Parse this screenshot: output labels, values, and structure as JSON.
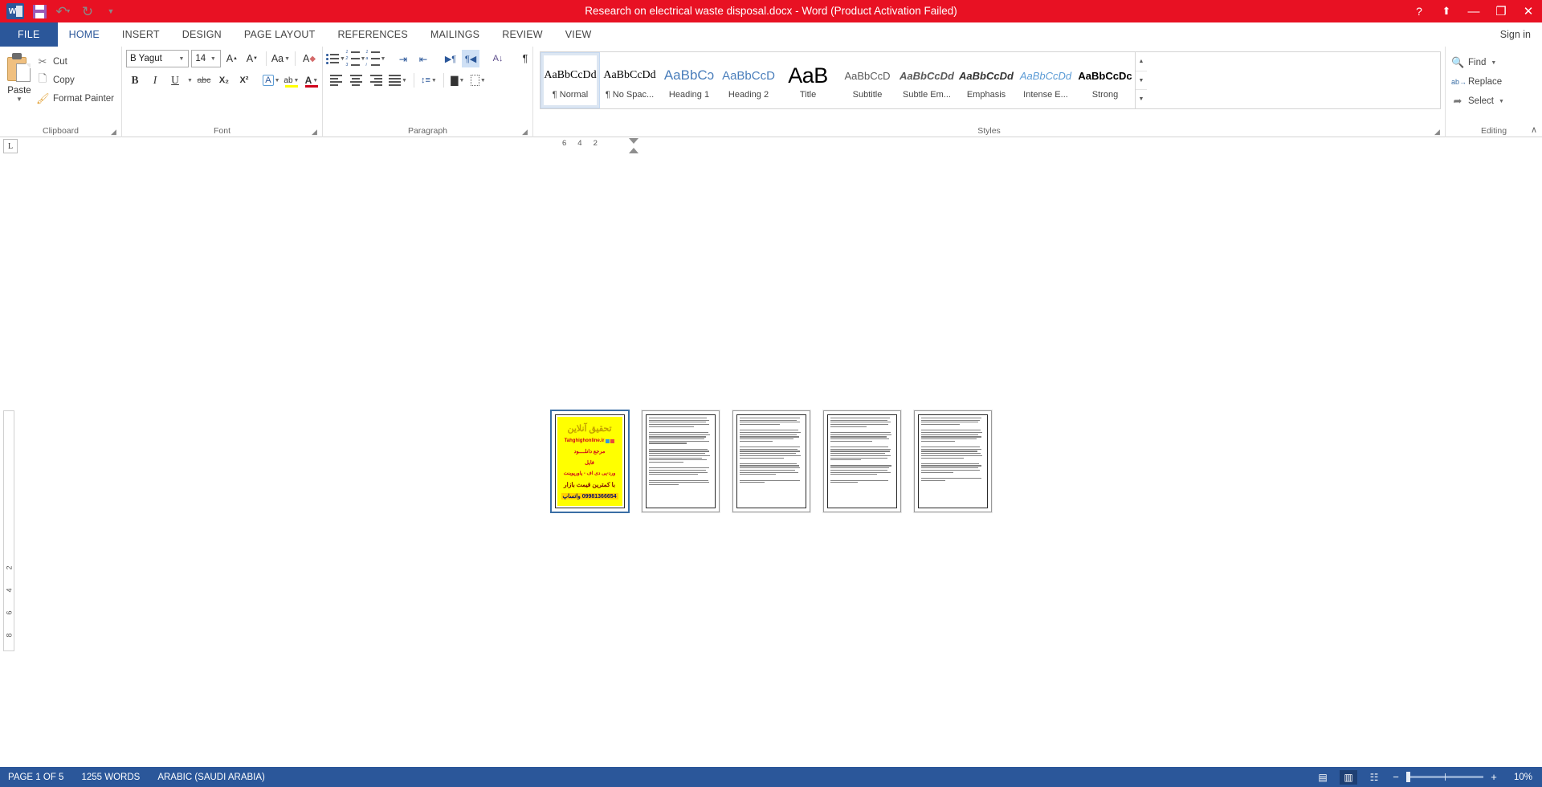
{
  "titlebar": {
    "title": "Research on electrical waste disposal.docx -  Word (Product Activation Failed)",
    "qat": [
      {
        "name": "word-app-icon",
        "label": "W"
      },
      {
        "name": "save-icon",
        "label": ""
      },
      {
        "name": "undo-icon",
        "label": "↶"
      },
      {
        "name": "redo-icon",
        "label": "↻"
      },
      {
        "name": "customize-qat-icon",
        "label": "≡"
      }
    ],
    "help_label": "?",
    "ribbon_display_label": "⬆",
    "minimize_label": "—",
    "restore_label": "❐",
    "close_label": "✕"
  },
  "tabs": {
    "file": "FILE",
    "items": [
      {
        "label": "HOME",
        "active": true
      },
      {
        "label": "INSERT",
        "active": false
      },
      {
        "label": "DESIGN",
        "active": false
      },
      {
        "label": "PAGE LAYOUT",
        "active": false
      },
      {
        "label": "REFERENCES",
        "active": false
      },
      {
        "label": "MAILINGS",
        "active": false
      },
      {
        "label": "REVIEW",
        "active": false
      },
      {
        "label": "VIEW",
        "active": false
      }
    ],
    "signin": "Sign in"
  },
  "ribbon": {
    "clipboard": {
      "group_label": "Clipboard",
      "paste_label": "Paste",
      "cut_label": "Cut",
      "copy_label": "Copy",
      "format_painter_label": "Format Painter"
    },
    "font": {
      "group_label": "Font",
      "font_name": "B Yagut",
      "font_size": "14",
      "grow_label": "A",
      "shrink_label": "A",
      "change_case_label": "Aa",
      "clear_format_label": "A",
      "bold_label": "B",
      "italic_label": "I",
      "underline_label": "U",
      "strike_label": "abc",
      "subscript_label": "X₂",
      "superscript_label": "X²",
      "text_effects_label": "A",
      "highlight_label": "ab",
      "font_color_label": "A"
    },
    "paragraph": {
      "group_label": "Paragraph",
      "show_marks_label": "¶",
      "sort_label": "A↓",
      "ltr_label": "▶¶",
      "rtl_label": "¶◀",
      "align_left_label": "",
      "align_center_label": "",
      "align_right_label": "",
      "justify_label": "",
      "line_spacing_label": "",
      "shading_label": "",
      "borders_label": ""
    },
    "styles": {
      "group_label": "Styles",
      "items": [
        {
          "preview": "AaBbCcDd",
          "name": "¶ Normal",
          "cls": "sp-normal",
          "selected": true
        },
        {
          "preview": "AaBbCcDd",
          "name": "¶ No Spac...",
          "cls": "sp-nospace",
          "selected": false
        },
        {
          "preview": "AaBbCɔ",
          "name": "Heading 1",
          "cls": "sp-h1",
          "selected": false
        },
        {
          "preview": "AaBbCcD",
          "name": "Heading 2",
          "cls": "sp-h2",
          "selected": false
        },
        {
          "preview": "AaB",
          "name": "Title",
          "cls": "sp-title",
          "selected": false
        },
        {
          "preview": "AaBbCcD",
          "name": "Subtitle",
          "cls": "sp-sub",
          "selected": false
        },
        {
          "preview": "AaBbCcDd",
          "name": "Subtle Em...",
          "cls": "sp-subem",
          "selected": false
        },
        {
          "preview": "AaBbCcDd",
          "name": "Emphasis",
          "cls": "sp-emph",
          "selected": false
        },
        {
          "preview": "AaBbCcDd",
          "name": "Intense E...",
          "cls": "sp-intense",
          "selected": false
        },
        {
          "preview": "AaBbCcDc",
          "name": "Strong",
          "cls": "sp-strong",
          "selected": false
        }
      ]
    },
    "editing": {
      "group_label": "Editing",
      "find_label": "Find",
      "replace_label": "Replace",
      "select_label": "Select"
    },
    "collapse_label": "∧"
  },
  "ruler": {
    "tabstop_label": "L",
    "h_numbers": [
      "6",
      "4",
      "2"
    ],
    "v_numbers": [
      "2",
      "4",
      "6",
      "8"
    ]
  },
  "document": {
    "pages": [
      {
        "index": 1,
        "selected": true,
        "type": "cover",
        "cover": {
          "title": "تحقیق آنلاین",
          "site": "Tahghighonline.ir",
          "line3": "مرجع دانلــــود",
          "line4": "فایل",
          "line5": "ورد-پی دی اف - پاورپوینت",
          "line6": "با کمترین قیمت بازار",
          "line7": "09981366654 واتساپ"
        }
      },
      {
        "index": 2,
        "selected": false,
        "type": "text"
      },
      {
        "index": 3,
        "selected": false,
        "type": "text"
      },
      {
        "index": 4,
        "selected": false,
        "type": "text"
      },
      {
        "index": 5,
        "selected": false,
        "type": "text"
      }
    ]
  },
  "statusbar": {
    "page_info": "PAGE 1 OF 5",
    "word_count": "1255 WORDS",
    "language": "ARABIC (SAUDI ARABIA)",
    "read_mode_label": "▤",
    "print_layout_label": "▥",
    "web_layout_label": "☷",
    "zoom_out_label": "−",
    "zoom_in_label": "+",
    "zoom_level": "10%"
  }
}
